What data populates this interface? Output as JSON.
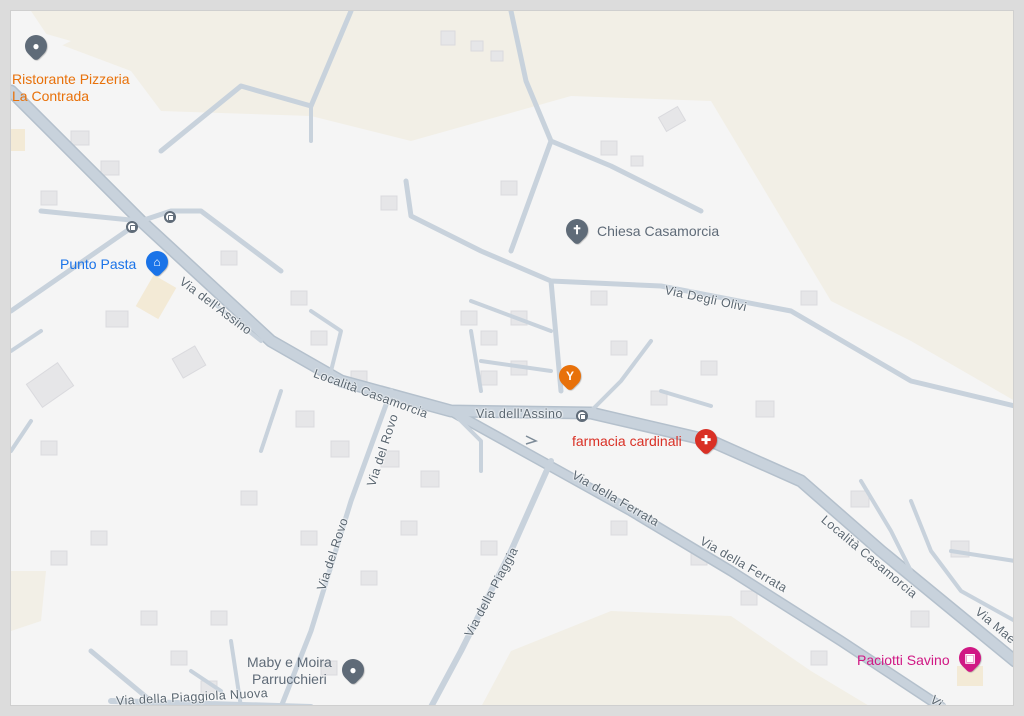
{
  "map": {
    "colors": {
      "background": "#f5f5f5",
      "land_tan": "#f2efe6",
      "road": "#c8d2dc",
      "road_outline": "#b4c0cc",
      "building": "#e6e6e8",
      "label_street": "#5a6670",
      "poi_restaurant": "#e8710a",
      "poi_generic": "#5f6b78",
      "poi_blue": "#1a73e8",
      "poi_pharmacy": "#d93025",
      "poi_pink": "#d01884",
      "poi_orange_pin": "#e8710a"
    },
    "pois": [
      {
        "id": "ristorante",
        "name_line1": "Ristorante Pizzeria",
        "name_line2": "La Contrada",
        "icon": "generic-pin-icon",
        "color": "#e8710a"
      },
      {
        "id": "punto-pasta",
        "name": "Punto Pasta",
        "icon": "shopping-bag-icon",
        "color": "#1a73e8"
      },
      {
        "id": "chiesa",
        "name": "Chiesa Casamorcia",
        "icon": "cross-icon",
        "color": "#5f6b78"
      },
      {
        "id": "farmacia",
        "name": "farmacia cardinali",
        "icon": "pharmacy-icon",
        "color": "#d93025"
      },
      {
        "id": "bar",
        "name": "",
        "icon": "cocktail-icon",
        "color": "#e8710a"
      },
      {
        "id": "maby",
        "name_line1": "Maby e Moira",
        "name_line2": "Parrucchieri",
        "icon": "generic-pin-icon",
        "color": "#5f6b78"
      },
      {
        "id": "paciotti",
        "name": "Paciotti Savino",
        "icon": "store-icon",
        "color": "#d01884"
      }
    ],
    "streets": [
      {
        "id": "via-dell-assino-1",
        "name": "Via dell'Assino"
      },
      {
        "id": "localita-casamorcia-1",
        "name": "Località Casamorcia"
      },
      {
        "id": "via-dell-assino-2",
        "name": "Via dell'Assino"
      },
      {
        "id": "via-degli-olivi",
        "name": "Via Degli Olivi"
      },
      {
        "id": "via-del-rovo-1",
        "name": "Via del Rovo"
      },
      {
        "id": "via-del-rovo-2",
        "name": "Via del Rovo"
      },
      {
        "id": "via-della-ferrata-1",
        "name": "Via della Ferrata"
      },
      {
        "id": "via-della-ferrata-2",
        "name": "Via della Ferrata"
      },
      {
        "id": "via-della-piaggia",
        "name": "Via della Piaggia"
      },
      {
        "id": "localita-casamorcia-2",
        "name": "Località Casamorcia"
      },
      {
        "id": "via-della-piaggiola-nuova",
        "name": "Via della Piaggiola Nuova"
      },
      {
        "id": "via-mae",
        "name": "Via Mae"
      },
      {
        "id": "via-bottom-right",
        "name": "Via"
      }
    ]
  }
}
